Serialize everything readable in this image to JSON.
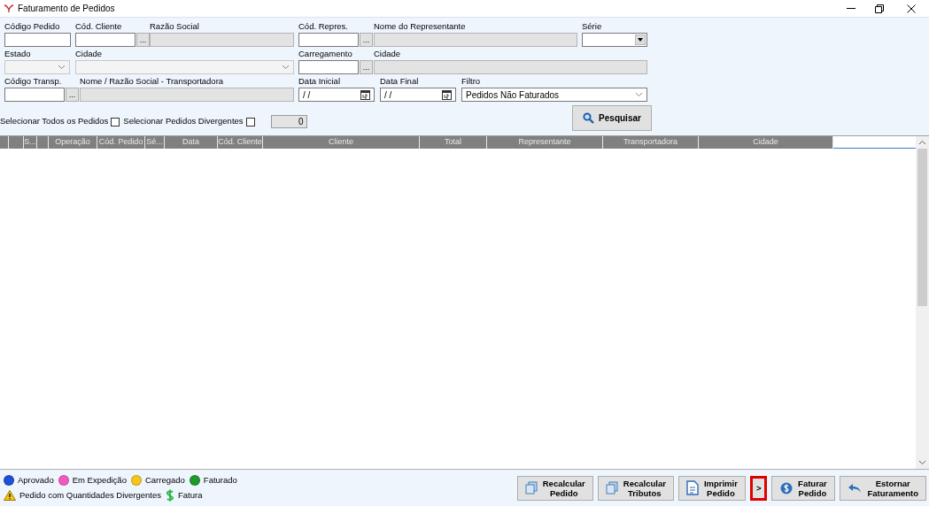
{
  "window": {
    "title": "Faturamento de Pedidos"
  },
  "form_rows": [
    [
      {
        "label": "Código Pedido",
        "kind": "text"
      },
      {
        "label": "Cód. Cliente",
        "kind": "lookup",
        "button": "..."
      },
      {
        "label": "Razão Social",
        "kind": "readonly"
      },
      {
        "label": "Cód. Repres.",
        "kind": "lookup",
        "button": "..."
      },
      {
        "label": "Nome do Representante",
        "kind": "readonly"
      },
      {
        "label": "Série",
        "kind": "select"
      }
    ],
    [
      {
        "label": "Estado",
        "kind": "disabled-select"
      },
      {
        "label": "Cidade",
        "kind": "disabled-select"
      },
      {
        "label": "Carregamento",
        "kind": "lookup",
        "button": "..."
      },
      {
        "label": "Cidade",
        "kind": "readonly"
      }
    ],
    [
      {
        "label": "Código Transp.",
        "kind": "lookup",
        "button": "..."
      },
      {
        "label": "Nome / Razão Social - Transportadora",
        "kind": "readonly"
      },
      {
        "label": "Data Inicial",
        "kind": "date",
        "value": "/ /"
      },
      {
        "label": "Data Final",
        "kind": "date",
        "value": "/ /"
      },
      {
        "label": "Filtro",
        "kind": "dropdown",
        "value": "Pedidos Não Faturados"
      }
    ]
  ],
  "checkboxes": [
    {
      "label": "Selecionar Todos os Pedidos",
      "checked": false
    },
    {
      "label": "Selecionar Pedidos Divergentes",
      "checked": false
    }
  ],
  "count": "0",
  "search_button": "Pesquisar",
  "table": {
    "columns": [
      {
        "kind": "blank"
      },
      {
        "kind": "blank"
      },
      {
        "kind": "text",
        "label": "S..."
      },
      {
        "kind": "blank"
      },
      {
        "kind": "text",
        "label": "Operação"
      },
      {
        "kind": "text",
        "label": "Cód. Pedido"
      },
      {
        "kind": "text",
        "label": "Sé..."
      },
      {
        "kind": "text",
        "label": "Data"
      },
      {
        "kind": "text",
        "label": "Cód. Cliente"
      },
      {
        "kind": "text",
        "label": "Cliente"
      },
      {
        "kind": "text",
        "label": "Total"
      },
      {
        "kind": "text",
        "label": "Representante"
      },
      {
        "kind": "text",
        "label": "Transportadora"
      },
      {
        "kind": "text",
        "label": "Cidade"
      }
    ]
  },
  "legend": [
    {
      "kind": "dot",
      "label": "Aprovado",
      "color": "#1f4fd6"
    },
    {
      "kind": "dot",
      "label": "Em Expedição",
      "color": "#f25bbd"
    },
    {
      "kind": "dot",
      "label": "Carregado",
      "color": "#f5c518"
    },
    {
      "kind": "dot",
      "label": "Faturado",
      "color": "#1e9a2a"
    },
    {
      "kind": "warning",
      "label": "Pedido com Quantidades Divergentes"
    },
    {
      "kind": "dollar",
      "label": "Fatura"
    }
  ],
  "actions": [
    {
      "kind": "copy",
      "lines": [
        "Recalcular",
        "Pedido"
      ],
      "highlighted": false
    },
    {
      "kind": "copy",
      "lines": [
        "Recalcular",
        "Tributos"
      ],
      "highlighted": false
    },
    {
      "kind": "document",
      "lines": [
        "Imprimir",
        "Pedido"
      ],
      "highlighted": false
    },
    {
      "kind": "more",
      "lines": [
        ">"
      ],
      "highlighted": true
    },
    {
      "kind": "coin",
      "lines": [
        "Faturar",
        "Pedido"
      ],
      "highlighted": false
    },
    {
      "kind": "undo",
      "lines": [
        "Estornar",
        "Faturamento"
      ],
      "highlighted": false
    }
  ]
}
